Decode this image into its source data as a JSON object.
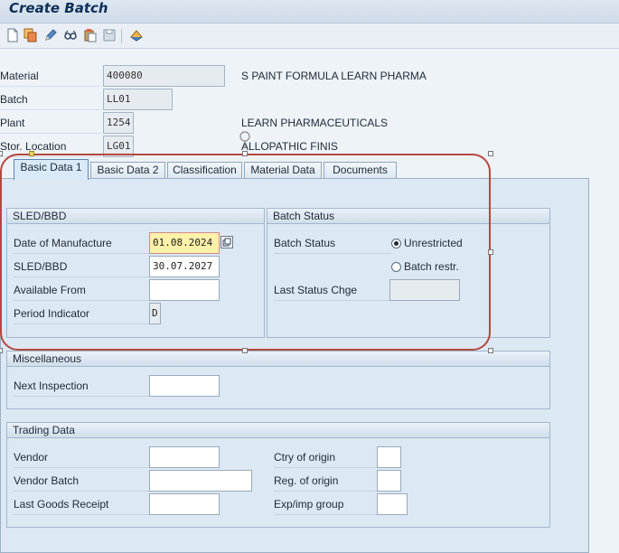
{
  "window": {
    "title": "Create Batch"
  },
  "toolbar": {
    "icons": [
      "new-document-icon",
      "copy-icon",
      "edit-icon",
      "display-change-icon",
      "paste-icon",
      "save-variant-icon",
      "classification-icon"
    ]
  },
  "header": {
    "material_label": "Material",
    "material_value": "400080",
    "material_desc": "S PAINT FORMULA LEARN PHARMA",
    "batch_label": "Batch",
    "batch_value": "LL01",
    "plant_label": "Plant",
    "plant_value": "1254",
    "plant_desc": "LEARN PHARMACEUTICALS",
    "sloc_label": "Stor. Location",
    "sloc_value": "LG01",
    "sloc_desc": "ALLOPATHIC FINIS"
  },
  "tabs": [
    {
      "label": "Basic Data 1",
      "active": true
    },
    {
      "label": "Basic Data 2"
    },
    {
      "label": "Classification"
    },
    {
      "label": "Material Data"
    },
    {
      "label": "Documents"
    }
  ],
  "sled": {
    "title": "SLED/BBD",
    "dom_label": "Date of Manufacture",
    "dom_value": "01.08.2024",
    "sled_label": "SLED/BBD",
    "sled_value": "30.07.2027",
    "avail_label": "Available From",
    "avail_value": "",
    "period_label": "Period Indicator",
    "period_value": "D"
  },
  "status": {
    "title": "Batch Status",
    "status_label": "Batch Status",
    "unrestricted_label": "Unrestricted",
    "restricted_label": "Batch restr.",
    "selected": "unrestricted",
    "last_change_label": "Last Status Chge",
    "last_change_value": ""
  },
  "misc": {
    "title": "Miscellaneous",
    "next_inspection_label": "Next Inspection",
    "next_inspection_value": ""
  },
  "trading": {
    "title": "Trading Data",
    "vendor_label": "Vendor",
    "vendor_value": "",
    "vendor_batch_label": "Vendor Batch",
    "vendor_batch_value": "",
    "last_gr_label": "Last Goods Receipt",
    "last_gr_value": "",
    "ctry_label": "Ctry of origin",
    "ctry_value": "",
    "region_label": "Reg. of origin",
    "region_value": "",
    "expimp_label": "Exp/imp group",
    "expimp_value": ""
  },
  "colors": {
    "annotation": "#b5473f",
    "highlight_field": "#fff2a8",
    "panel_bg": "#dce8f3"
  }
}
